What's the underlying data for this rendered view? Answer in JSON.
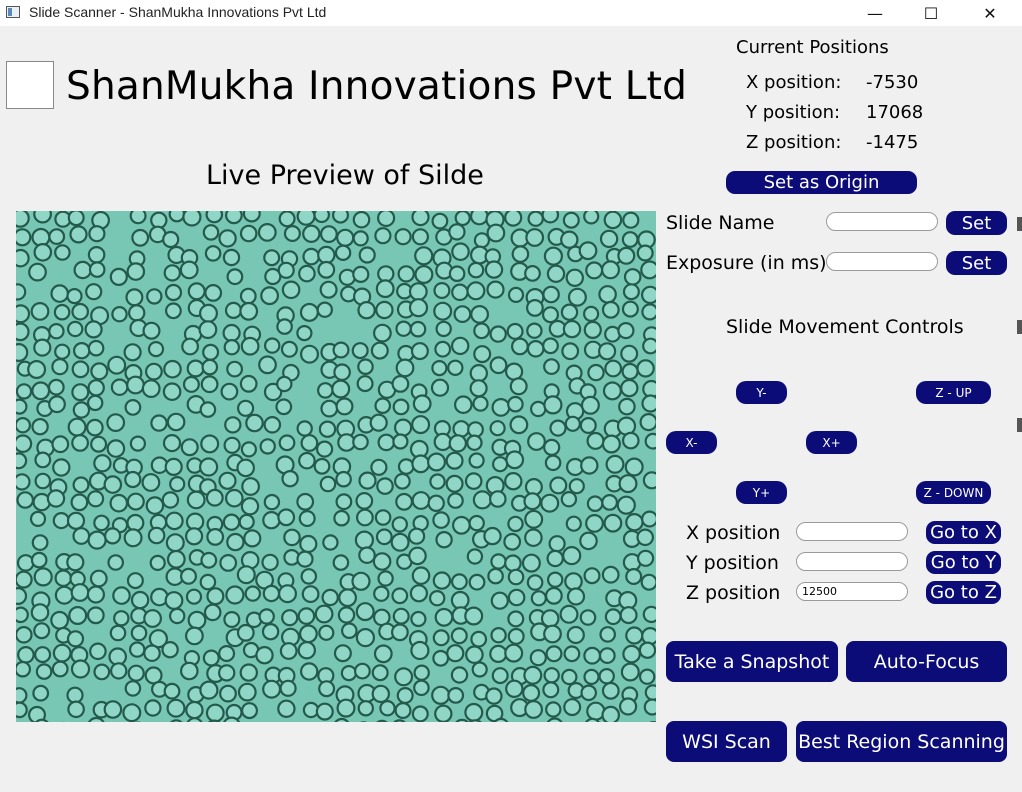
{
  "window": {
    "title": "Slide Scanner - ShanMukha Innovations Pvt Ltd",
    "minimize_glyph": "—",
    "maximize_glyph": "☐",
    "close_glyph": "✕"
  },
  "header": {
    "company": "ShanMukha Innovations Pvt Ltd",
    "preview_title": "Live Preview of Silde"
  },
  "positions": {
    "heading": "Current Positions",
    "x_label": "X position:",
    "x_value": "-7530",
    "y_label": "Y position:",
    "y_value": "17068",
    "z_label": "Z position:",
    "z_value": "-1475",
    "set_origin_label": "Set as Origin"
  },
  "settings": {
    "slide_name_label": "Slide Name",
    "slide_name_value": "",
    "exposure_label": "Exposure (in ms)",
    "exposure_value": "",
    "set_label": "Set"
  },
  "movement": {
    "heading": "Slide Movement Controls",
    "y_minus": "Y-",
    "y_plus": "Y+",
    "x_minus": "X-",
    "x_plus": "X+",
    "z_up": "Z - UP",
    "z_down": "Z - DOWN"
  },
  "goto": {
    "x_label": "X position",
    "x_value": "",
    "x_button": "Go to X",
    "y_label": "Y position",
    "y_value": "",
    "y_button": "Go to Y",
    "z_label": "Z position",
    "z_value": "12500",
    "z_button": "Go to Z"
  },
  "actions": {
    "snapshot": "Take a Snapshot",
    "autofocus": "Auto-Focus",
    "wsi_scan": "WSI Scan",
    "best_region": "Best Region Scanning"
  },
  "colors": {
    "button_bg": "#0c0c78",
    "preview_bg": "#78c6b4",
    "cell_ring": "#245a4c",
    "cell_center": "#8fd6c6"
  },
  "icons": {
    "app": "app-window-icon",
    "minimize": "minimize-icon",
    "maximize": "maximize-icon",
    "close": "close-icon"
  }
}
